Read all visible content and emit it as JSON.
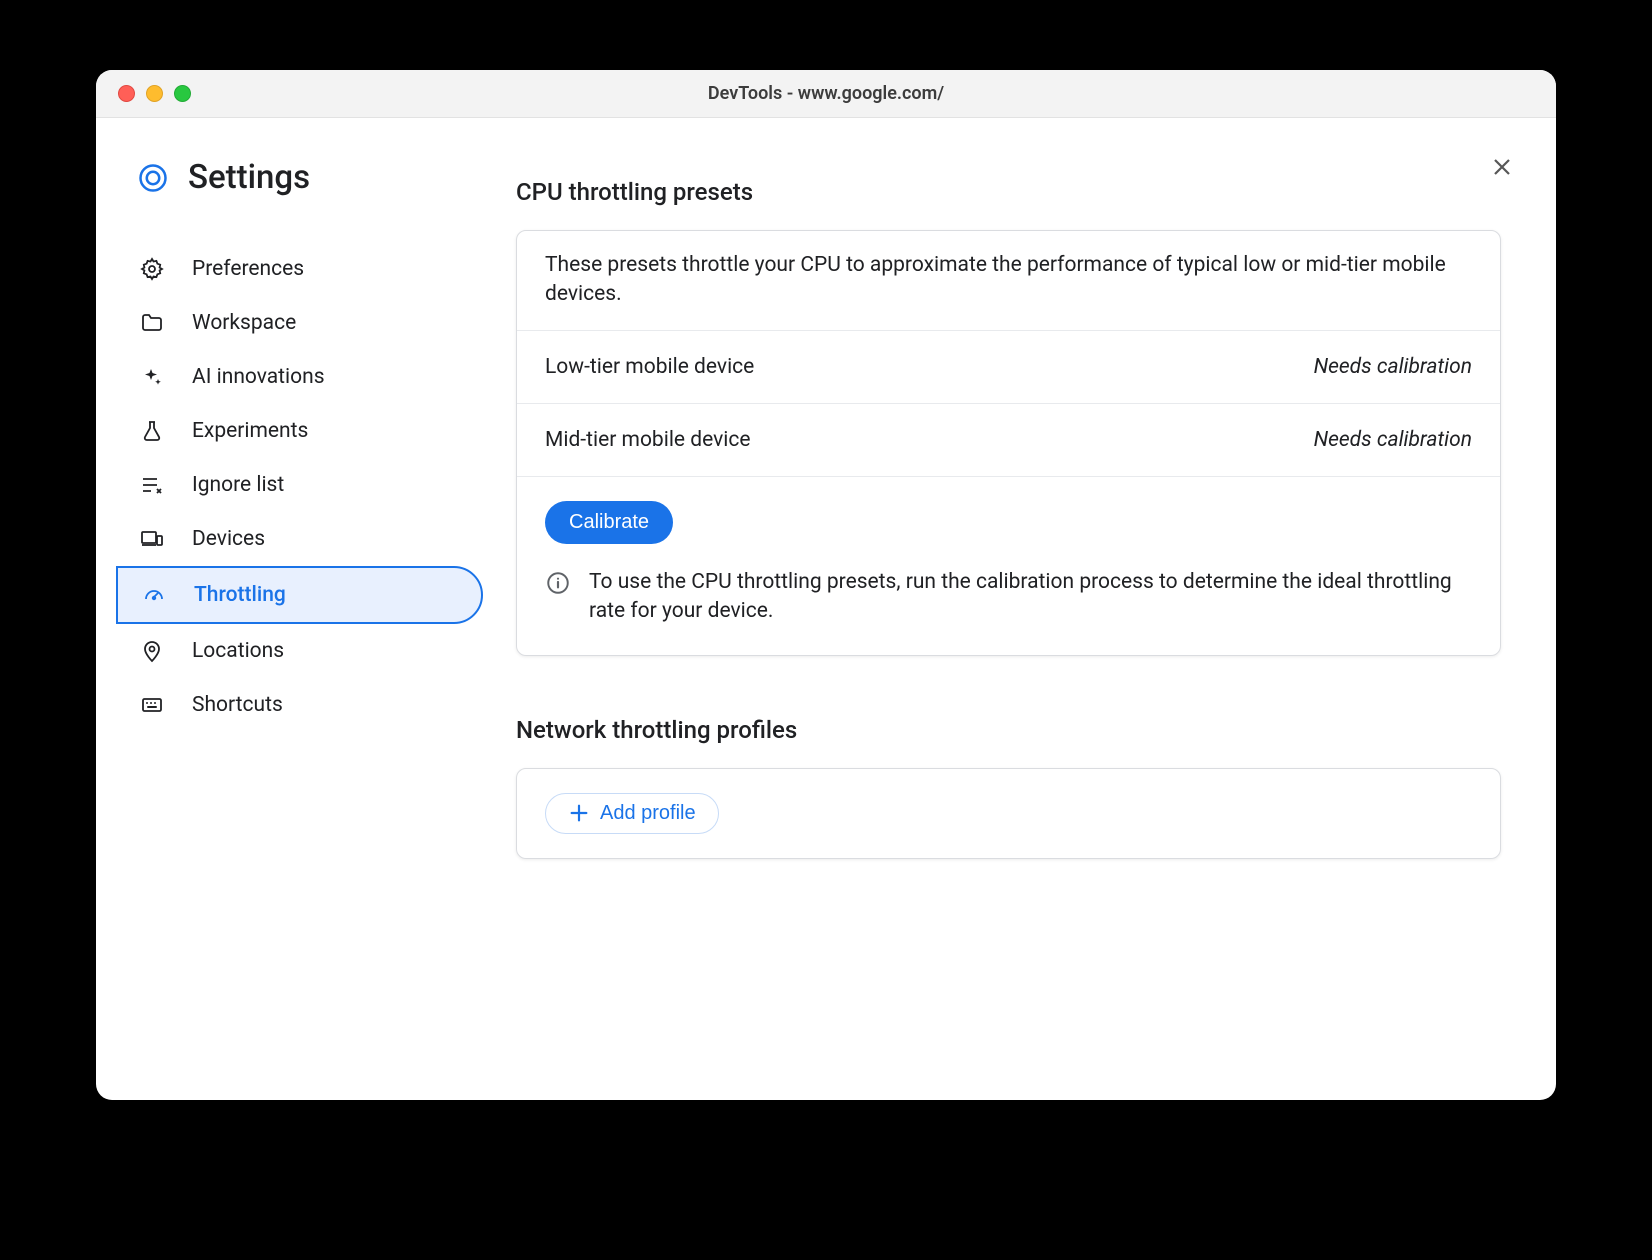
{
  "window": {
    "title": "DevTools - www.google.com/"
  },
  "settings": {
    "heading": "Settings"
  },
  "nav": {
    "items": [
      {
        "label": "Preferences"
      },
      {
        "label": "Workspace"
      },
      {
        "label": "AI innovations"
      },
      {
        "label": "Experiments"
      },
      {
        "label": "Ignore list"
      },
      {
        "label": "Devices"
      },
      {
        "label": "Throttling"
      },
      {
        "label": "Locations"
      },
      {
        "label": "Shortcuts"
      }
    ]
  },
  "cpu": {
    "section_title": "CPU throttling presets",
    "intro": "These presets throttle your CPU to approximate the performance of typical low or mid-tier mobile devices.",
    "presets": [
      {
        "name": "Low-tier mobile device",
        "status": "Needs calibration"
      },
      {
        "name": "Mid-tier mobile device",
        "status": "Needs calibration"
      }
    ],
    "calibrate_label": "Calibrate",
    "info_text": "To use the CPU throttling presets, run the calibration process to determine the ideal throttling rate for your device."
  },
  "network": {
    "section_title": "Network throttling profiles",
    "add_profile_label": "Add profile"
  }
}
